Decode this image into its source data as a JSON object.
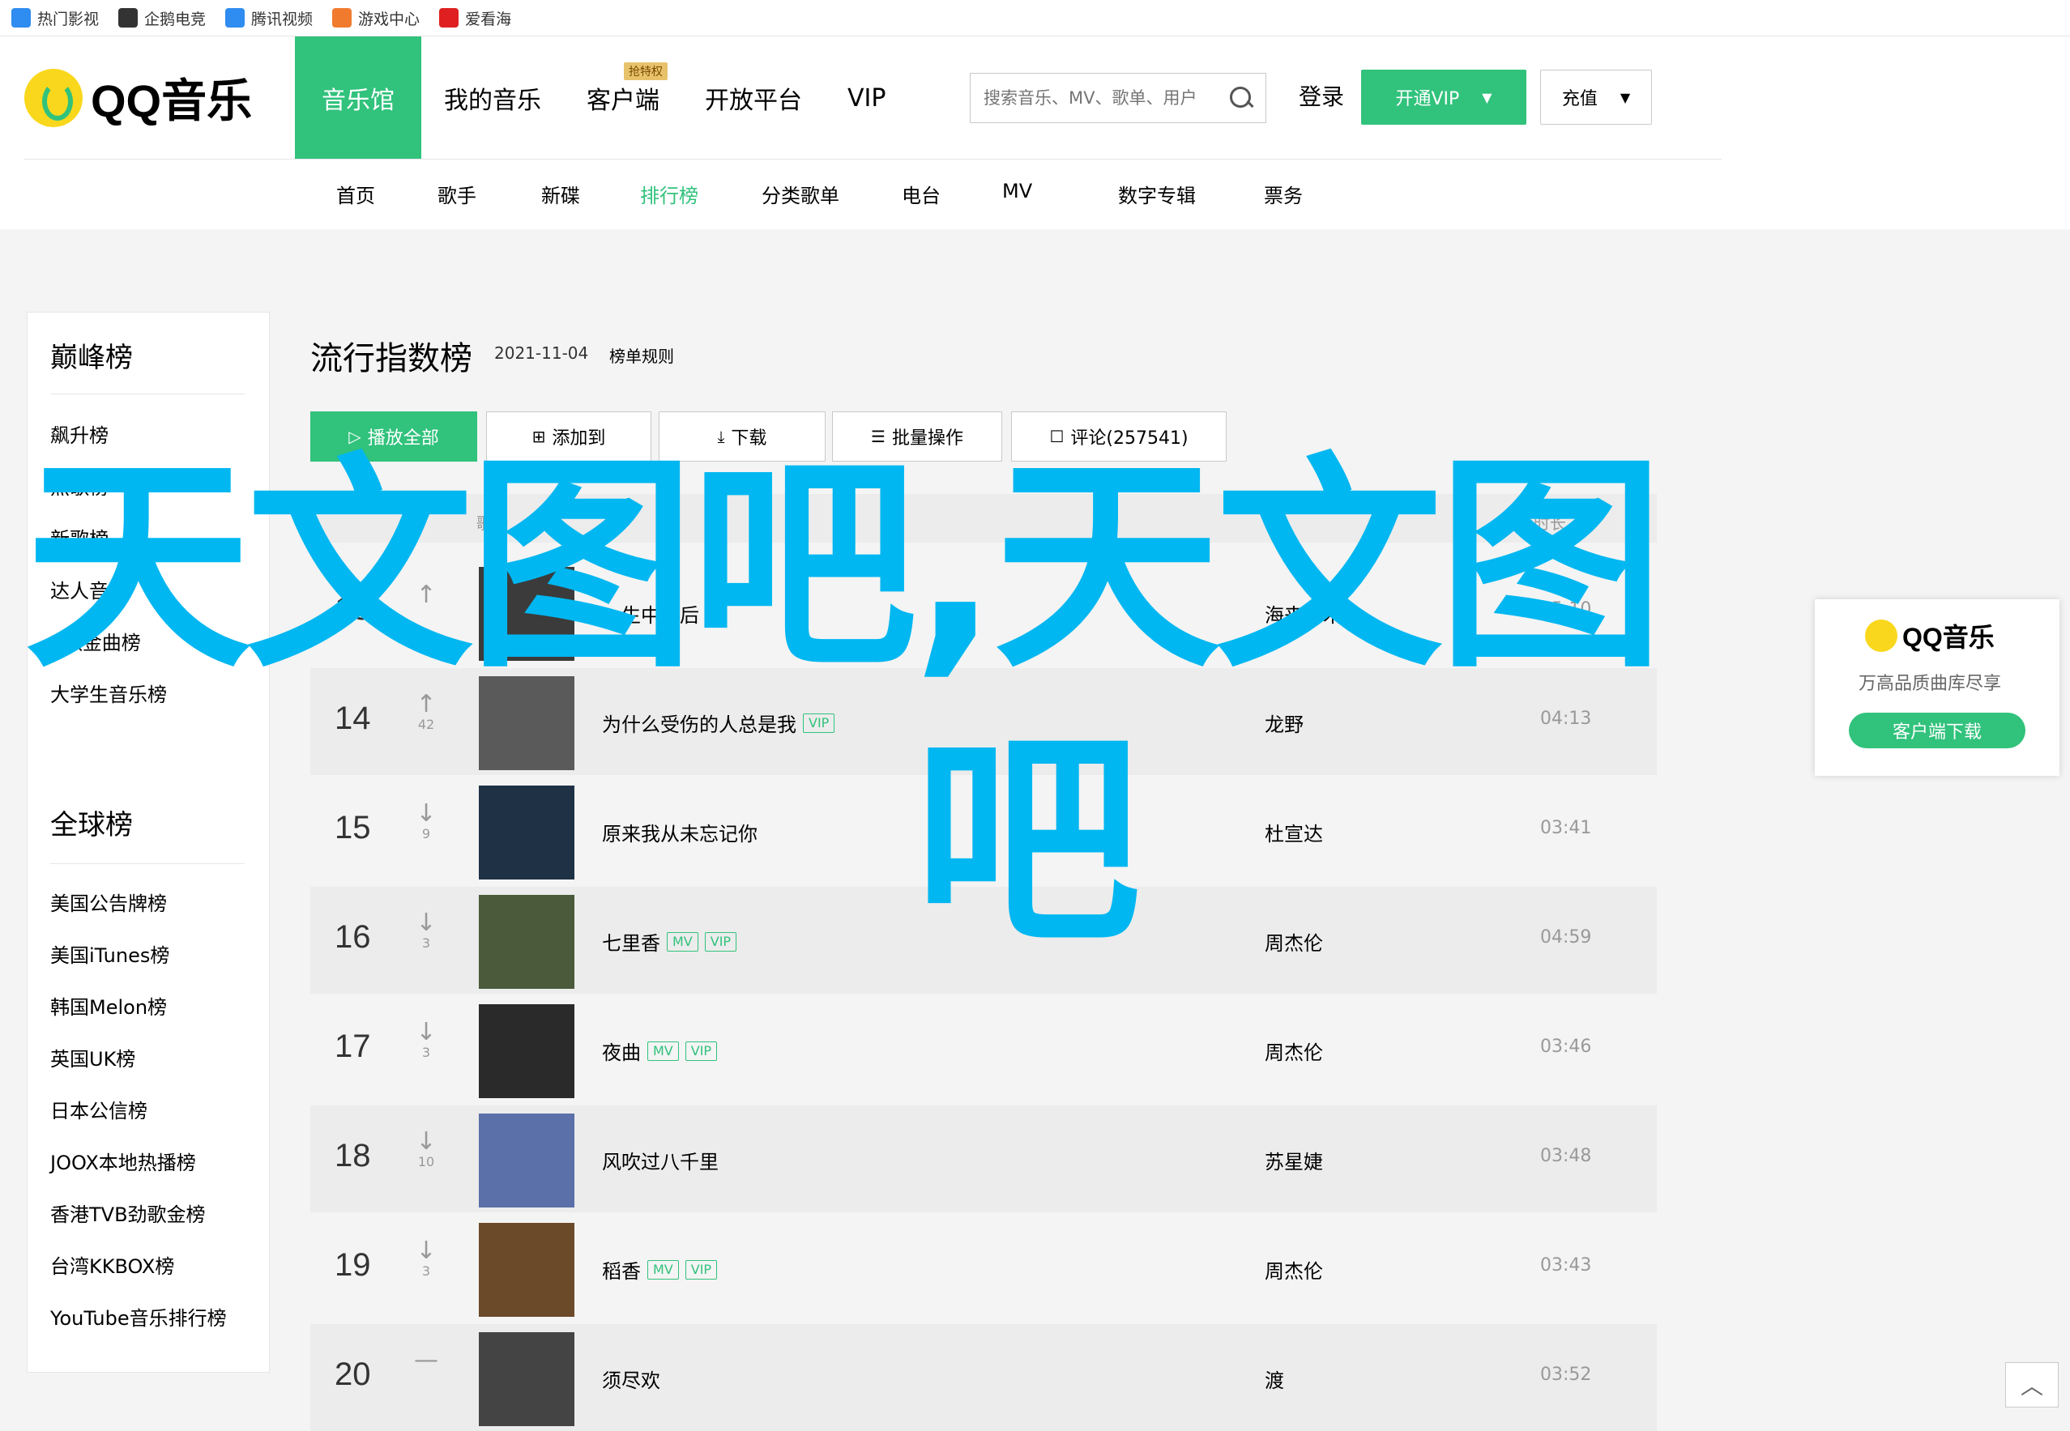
{
  "bookmarks": [
    {
      "label": "热门影视",
      "icon": "tv-icon",
      "color": "#2f8cf0"
    },
    {
      "label": "企鹅电竞",
      "icon": "penguin-icon",
      "color": "#333333"
    },
    {
      "label": "腾讯视频",
      "icon": "play-icon",
      "color": "#2f8cf0"
    },
    {
      "label": "游戏中心",
      "icon": "gamepad-icon",
      "color": "#f07b2f"
    },
    {
      "label": "爱看海",
      "icon": "heart-icon",
      "color": "#e02020"
    }
  ],
  "logo": {
    "text": "QQ音乐"
  },
  "topnav": [
    {
      "label": "音乐馆"
    },
    {
      "label": "我的音乐"
    },
    {
      "label": "客户端",
      "badge": "抢特权"
    },
    {
      "label": "开放平台"
    },
    {
      "label": "VIP"
    }
  ],
  "search": {
    "placeholder": "搜索音乐、MV、歌单、用户"
  },
  "header_actions": {
    "login": "登录",
    "vip": "开通VIP",
    "charge": "充值",
    "caret": "▼"
  },
  "subnav": [
    "首页",
    "歌手",
    "新碟",
    "排行榜",
    "分类歌单",
    "电台",
    "MV",
    "数字专辑",
    "票务"
  ],
  "sidebar": {
    "section1_title": "巅峰榜",
    "section1_items": [
      "飙升榜",
      "热歌榜",
      "新歌榜",
      "达人音乐",
      "K歌金曲榜",
      "大学生音乐榜"
    ],
    "section2_title": "全球榜",
    "section2_items": [
      "美国公告牌榜",
      "美国iTunes榜",
      "韩国Melon榜",
      "英国UK榜",
      "日本公信榜",
      "JOOX本地热播榜",
      "香港TVB劲歌金榜",
      "台湾KKBOX榜",
      "YouTube音乐排行榜"
    ]
  },
  "chart": {
    "title": "流行指数榜",
    "date": "2021-11-04",
    "rule": "榜单规则"
  },
  "toolbar": [
    {
      "label": "播放全部",
      "icon": "▷"
    },
    {
      "label": "添加到",
      "icon": "⊞"
    },
    {
      "label": "下载",
      "icon": "⤓"
    },
    {
      "label": "批量操作",
      "icon": "☰"
    },
    {
      "label": "评论(257541)",
      "icon": "☐"
    }
  ],
  "table_headers": {
    "song": "歌曲",
    "duration": "时长"
  },
  "rows": [
    {
      "rank": "13",
      "trend": "↑",
      "change": "",
      "title": "一生中以后",
      "tags": [],
      "singer": "海来阿木",
      "duration": "05:10",
      "cover": "#3b3b3b"
    },
    {
      "rank": "14",
      "trend": "↑",
      "change": "42",
      "title": "为什么受伤的人总是我",
      "tags": [
        "VIP"
      ],
      "singer": "龙野",
      "duration": "04:13",
      "cover": "#5a5a5a"
    },
    {
      "rank": "15",
      "trend": "↓",
      "change": "9",
      "title": "原来我从未忘记你",
      "tags": [],
      "singer": "杜宣达",
      "duration": "03:41",
      "cover": "#1f3245"
    },
    {
      "rank": "16",
      "trend": "↓",
      "change": "3",
      "title": "七里香",
      "tags": [
        "MV",
        "VIP"
      ],
      "singer": "周杰伦",
      "duration": "04:59",
      "cover": "#4a5a3a"
    },
    {
      "rank": "17",
      "trend": "↓",
      "change": "3",
      "title": "夜曲",
      "tags": [
        "MV",
        "VIP"
      ],
      "singer": "周杰伦",
      "duration": "03:46",
      "cover": "#2a2a2a"
    },
    {
      "rank": "18",
      "trend": "↓",
      "change": "10",
      "title": "风吹过八千里",
      "tags": [],
      "singer": "苏星婕",
      "duration": "03:48",
      "cover": "#5b6fa8"
    },
    {
      "rank": "19",
      "trend": "↓",
      "change": "3",
      "title": "稻香",
      "tags": [
        "MV",
        "VIP"
      ],
      "singer": "周杰伦",
      "duration": "03:43",
      "cover": "#6b4a2a"
    },
    {
      "rank": "20",
      "trend": "—",
      "change": "",
      "title": "须尽欢",
      "tags": [],
      "singer": "渡",
      "duration": "03:52",
      "cover": "#444444"
    }
  ],
  "watermark": {
    "line1": "天文图吧,天文图",
    "line2": "吧"
  },
  "download_widget": {
    "logo": "QQ音乐",
    "slogan": "万高品质曲库尽享",
    "button": "客户端下载"
  },
  "back_to_top": "︿"
}
